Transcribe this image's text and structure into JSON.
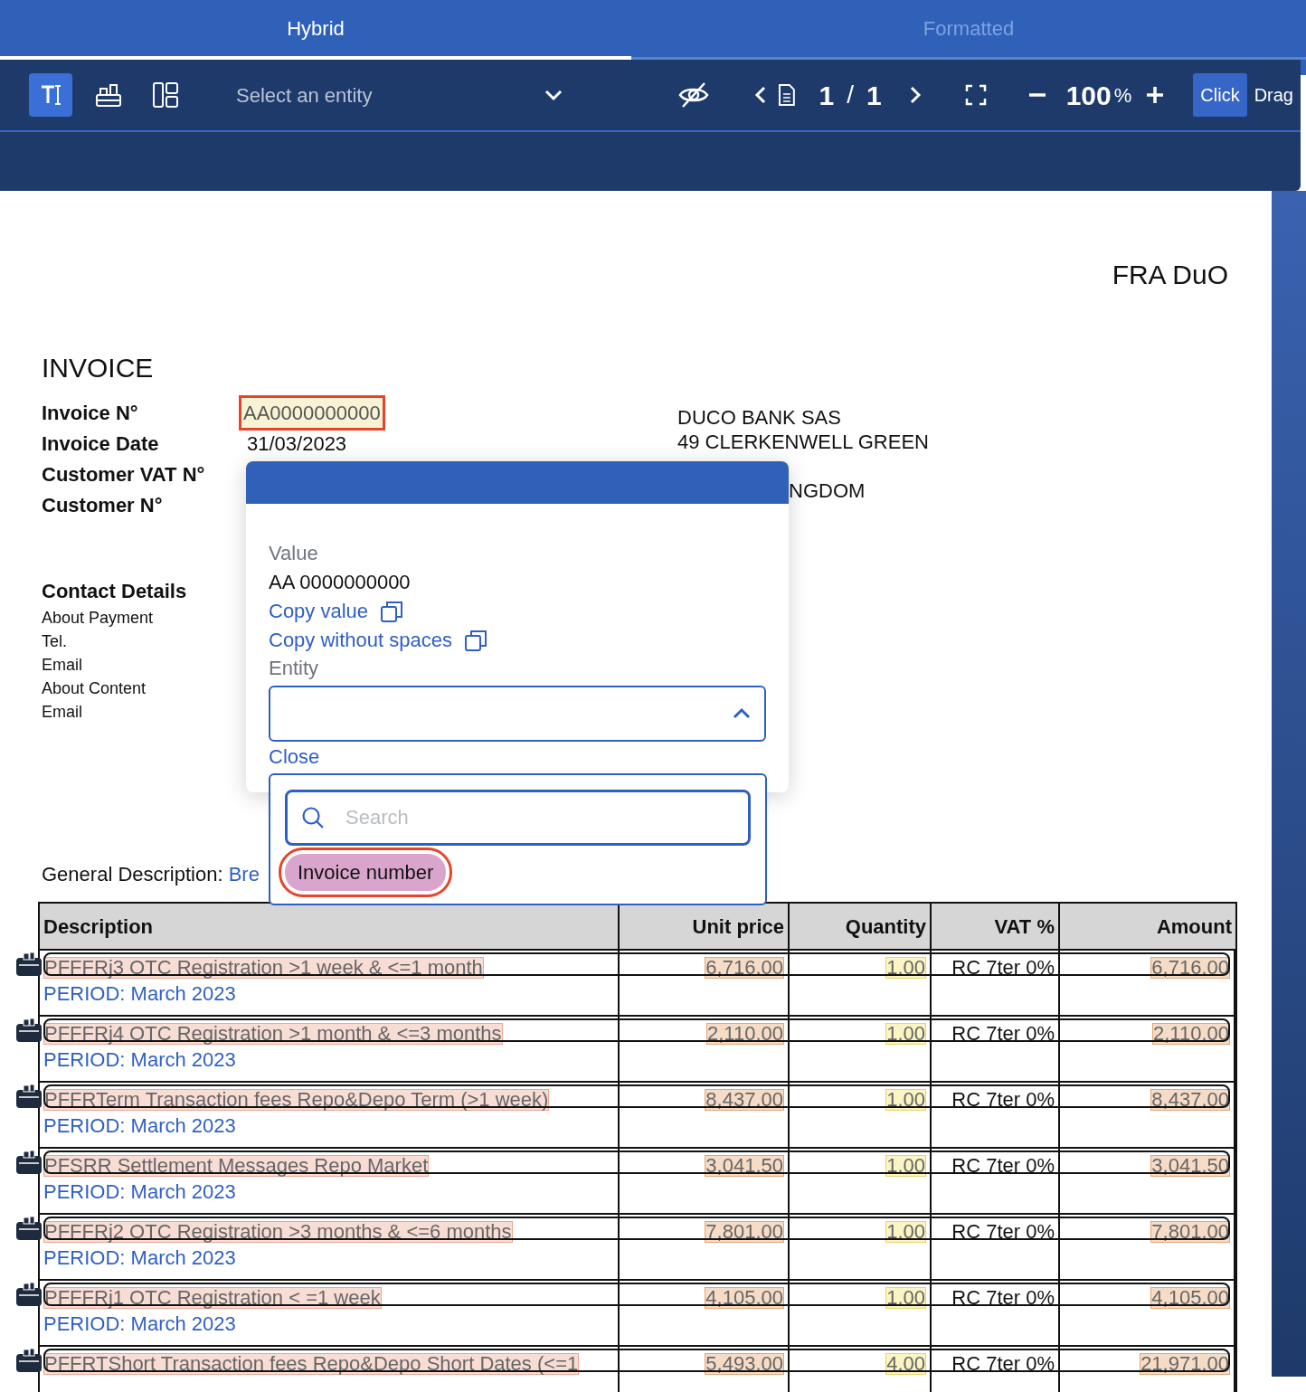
{
  "tabs": [
    {
      "label": "Hybrid",
      "selected": true
    },
    {
      "label": "Formatted",
      "selected": false
    }
  ],
  "toolbar": {
    "tools": [
      {
        "kind": "text",
        "selected": true
      },
      {
        "kind": "blocks",
        "selected": false
      },
      {
        "kind": "layout",
        "selected": false
      }
    ],
    "entity_select": {
      "placeholder": "Select an entity"
    },
    "page_current": "1",
    "page_separator": "/",
    "page_total": "1",
    "zoom": "100",
    "zoom_unit": "%",
    "modes": [
      {
        "label": "Click",
        "selected": true
      },
      {
        "label": "Drag",
        "selected": false
      }
    ]
  },
  "document": {
    "company": "FRA DuO",
    "title": "INVOICE",
    "fields": [
      {
        "label": "Invoice N°",
        "value": "AA0000000000",
        "annotated": true
      },
      {
        "label": "Invoice Date",
        "value": "31/03/2023",
        "annotated": false
      },
      {
        "label": "Customer VAT N°"
      },
      {
        "label": "Customer N°"
      }
    ],
    "address": [
      "DUCO BANK SAS",
      "49 CLERKENWELL GREEN"
    ],
    "address_cut": "NGDOM",
    "contact": {
      "title": "Contact Details",
      "lines": [
        "About Payment",
        "Tel.",
        "Email",
        "About Content",
        "Email"
      ]
    },
    "general_description": {
      "label": "General Description:",
      "value": "Bre"
    },
    "table": {
      "columns": [
        "Description",
        "Unit price",
        "Quantity",
        "VAT %",
        "Amount"
      ],
      "rows": [
        {
          "description": "PFFFRj3 OTC Registration >1 week & <=1 month",
          "period": "PERIOD: March 2023",
          "unit_price": "6,716.00",
          "quantity": "1.00",
          "vat": "RC 7ter 0%",
          "amount": "6,716.00",
          "annotated": true
        },
        {
          "description": "PFFFRj4 OTC Registration >1 month & <=3 months",
          "period": "PERIOD: March 2023",
          "unit_price": "2,110.00",
          "quantity": "1.00",
          "vat": "RC 7ter 0%",
          "amount": "2,110.00",
          "annotated": true
        },
        {
          "description": "PFFRTerm Transaction fees Repo&Depo Term (>1 week)",
          "period": "PERIOD: March 2023",
          "unit_price": "8,437.00",
          "quantity": "1.00",
          "vat": "RC 7ter 0%",
          "amount": "8,437.00",
          "annotated": true
        },
        {
          "description": "PFSRR Settlement Messages Repo Market",
          "period": "PERIOD: March 2023",
          "unit_price": "3,041.50",
          "quantity": "1.00",
          "vat": "RC 7ter 0%",
          "amount": "3,041.50",
          "annotated": true
        },
        {
          "description": "PFFFRj2 OTC Registration >3 months & <=6 months",
          "period": "PERIOD: March 2023",
          "unit_price": "7,801.00",
          "quantity": "1.00",
          "vat": "RC 7ter 0%",
          "amount": "7,801.00",
          "annotated": true
        },
        {
          "description": "PFFFRj1 OTC Registration < =1 week",
          "period": "PERIOD: March 2023",
          "unit_price": "4,105.00",
          "quantity": "1.00",
          "vat": "RC 7ter 0%",
          "amount": "4,105.00",
          "annotated": true
        },
        {
          "description": "PFFRTShort Transaction fees Repo&Depo Short Dates (<=1",
          "unit_price": "5,493.00",
          "quantity": "4.00",
          "vat": "RC 7ter 0%",
          "amount": "21,971.00",
          "annotated": true
        }
      ]
    }
  },
  "popup": {
    "value_label": "Value",
    "value": "AA 0000000000",
    "actions": [
      "Copy value",
      "Copy without spaces"
    ],
    "entity_label": "Entity",
    "close": "Close"
  },
  "dropdown": {
    "search_placeholder": "Search",
    "options": [
      {
        "label": "Invoice number",
        "selected": true
      }
    ]
  }
}
